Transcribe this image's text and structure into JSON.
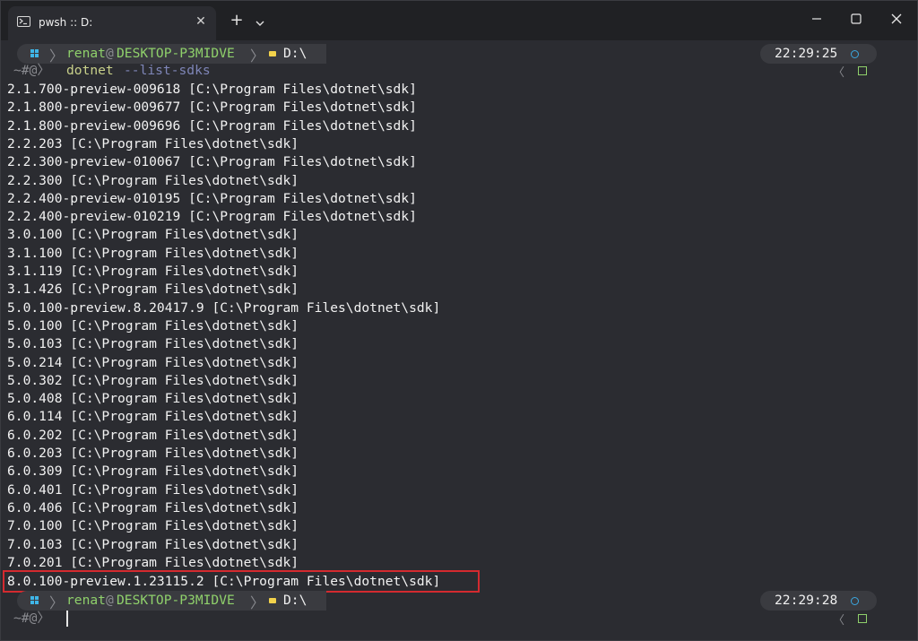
{
  "window": {
    "tab_title": "pwsh :: D:",
    "tab_close": "✕",
    "new_tab": "+"
  },
  "prompt": {
    "user": "renat",
    "at": "@",
    "host": "DESKTOP-P3MIDVE",
    "path": "D:\\",
    "ps_symbol": "~#@〉",
    "left_marker": "〈"
  },
  "first_prompt": {
    "time": "22:29:25",
    "command": "dotnet",
    "args": "--list-sdks"
  },
  "second_prompt": {
    "time": "22:29:28"
  },
  "output_lines": [
    "2.1.700-preview-009618 [C:\\Program Files\\dotnet\\sdk]",
    "2.1.800-preview-009677 [C:\\Program Files\\dotnet\\sdk]",
    "2.1.800-preview-009696 [C:\\Program Files\\dotnet\\sdk]",
    "2.2.203 [C:\\Program Files\\dotnet\\sdk]",
    "2.2.300-preview-010067 [C:\\Program Files\\dotnet\\sdk]",
    "2.2.300 [C:\\Program Files\\dotnet\\sdk]",
    "2.2.400-preview-010195 [C:\\Program Files\\dotnet\\sdk]",
    "2.2.400-preview-010219 [C:\\Program Files\\dotnet\\sdk]",
    "3.0.100 [C:\\Program Files\\dotnet\\sdk]",
    "3.1.100 [C:\\Program Files\\dotnet\\sdk]",
    "3.1.119 [C:\\Program Files\\dotnet\\sdk]",
    "3.1.426 [C:\\Program Files\\dotnet\\sdk]",
    "5.0.100-preview.8.20417.9 [C:\\Program Files\\dotnet\\sdk]",
    "5.0.100 [C:\\Program Files\\dotnet\\sdk]",
    "5.0.103 [C:\\Program Files\\dotnet\\sdk]",
    "5.0.214 [C:\\Program Files\\dotnet\\sdk]",
    "5.0.302 [C:\\Program Files\\dotnet\\sdk]",
    "5.0.408 [C:\\Program Files\\dotnet\\sdk]",
    "6.0.114 [C:\\Program Files\\dotnet\\sdk]",
    "6.0.202 [C:\\Program Files\\dotnet\\sdk]",
    "6.0.203 [C:\\Program Files\\dotnet\\sdk]",
    "6.0.309 [C:\\Program Files\\dotnet\\sdk]",
    "6.0.401 [C:\\Program Files\\dotnet\\sdk]",
    "6.0.406 [C:\\Program Files\\dotnet\\sdk]",
    "7.0.100 [C:\\Program Files\\dotnet\\sdk]",
    "7.0.103 [C:\\Program Files\\dotnet\\sdk]",
    "7.0.201 [C:\\Program Files\\dotnet\\sdk]",
    "8.0.100-preview.1.23115.2 [C:\\Program Files\\dotnet\\sdk]"
  ],
  "colors": {
    "highlight_border": "#d42a2f",
    "user_green": "#8fd06b",
    "command_yellow": "#c8d08a",
    "args_purple": "#7f86b8"
  }
}
